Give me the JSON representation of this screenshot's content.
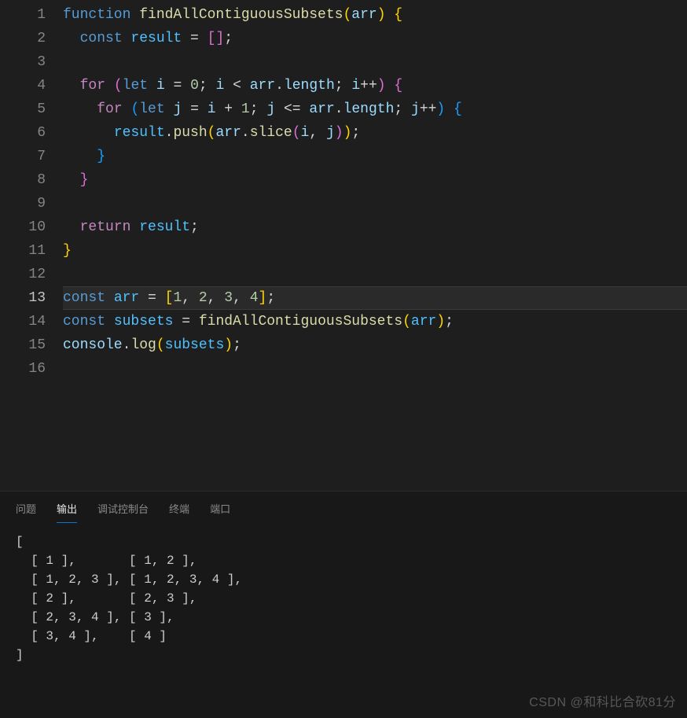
{
  "editor": {
    "highlighted_line_index": 12,
    "line_numbers": [
      "1",
      "2",
      "3",
      "4",
      "5",
      "6",
      "7",
      "8",
      "9",
      "10",
      "11",
      "12",
      "13",
      "14",
      "15",
      "16"
    ],
    "code_tokens": [
      [
        [
          "kw",
          "function "
        ],
        [
          "fn",
          "findAllContiguousSubsets"
        ],
        [
          "brR",
          "("
        ],
        [
          "var",
          "arr"
        ],
        [
          "brR",
          ") "
        ],
        [
          "brR",
          "{"
        ]
      ],
      [
        [
          "punc",
          "  "
        ],
        [
          "kw",
          "const "
        ],
        [
          "const",
          "result"
        ],
        [
          "punc",
          " = "
        ],
        [
          "brP",
          "["
        ],
        [
          "brP",
          "]"
        ],
        [
          "punc",
          ";"
        ]
      ],
      [],
      [
        [
          "punc",
          "  "
        ],
        [
          "ctrl",
          "for "
        ],
        [
          "brP",
          "("
        ],
        [
          "kw",
          "let "
        ],
        [
          "var",
          "i"
        ],
        [
          "punc",
          " = "
        ],
        [
          "num",
          "0"
        ],
        [
          "punc",
          "; "
        ],
        [
          "var",
          "i"
        ],
        [
          "punc",
          " < "
        ],
        [
          "var",
          "arr"
        ],
        [
          "punc",
          "."
        ],
        [
          "var",
          "length"
        ],
        [
          "punc",
          "; "
        ],
        [
          "var",
          "i"
        ],
        [
          "punc",
          "++"
        ],
        [
          "brP",
          ") "
        ],
        [
          "brP",
          "{"
        ]
      ],
      [
        [
          "punc",
          "    "
        ],
        [
          "ctrl",
          "for "
        ],
        [
          "brB",
          "("
        ],
        [
          "kw",
          "let "
        ],
        [
          "var",
          "j"
        ],
        [
          "punc",
          " = "
        ],
        [
          "var",
          "i"
        ],
        [
          "punc",
          " + "
        ],
        [
          "num",
          "1"
        ],
        [
          "punc",
          "; "
        ],
        [
          "var",
          "j"
        ],
        [
          "punc",
          " <= "
        ],
        [
          "var",
          "arr"
        ],
        [
          "punc",
          "."
        ],
        [
          "var",
          "length"
        ],
        [
          "punc",
          "; "
        ],
        [
          "var",
          "j"
        ],
        [
          "punc",
          "++"
        ],
        [
          "brB",
          ") "
        ],
        [
          "brB",
          "{"
        ]
      ],
      [
        [
          "punc",
          "      "
        ],
        [
          "const",
          "result"
        ],
        [
          "punc",
          "."
        ],
        [
          "fn",
          "push"
        ],
        [
          "brR",
          "("
        ],
        [
          "var",
          "arr"
        ],
        [
          "punc",
          "."
        ],
        [
          "fn",
          "slice"
        ],
        [
          "brP",
          "("
        ],
        [
          "var",
          "i"
        ],
        [
          "punc",
          ", "
        ],
        [
          "var",
          "j"
        ],
        [
          "brP",
          ")"
        ],
        [
          "brR",
          ")"
        ],
        [
          "punc",
          ";"
        ]
      ],
      [
        [
          "punc",
          "    "
        ],
        [
          "brB",
          "}"
        ]
      ],
      [
        [
          "punc",
          "  "
        ],
        [
          "brP",
          "}"
        ]
      ],
      [],
      [
        [
          "punc",
          "  "
        ],
        [
          "ctrl",
          "return "
        ],
        [
          "const",
          "result"
        ],
        [
          "punc",
          ";"
        ]
      ],
      [
        [
          "brR",
          "}"
        ]
      ],
      [],
      [
        [
          "kw",
          "const "
        ],
        [
          "const",
          "arr"
        ],
        [
          "punc",
          " = "
        ],
        [
          "brR",
          "["
        ],
        [
          "num",
          "1"
        ],
        [
          "punc",
          ", "
        ],
        [
          "num",
          "2"
        ],
        [
          "punc",
          ", "
        ],
        [
          "num",
          "3"
        ],
        [
          "punc",
          ", "
        ],
        [
          "num",
          "4"
        ],
        [
          "brR",
          "]"
        ],
        [
          "punc",
          ";"
        ]
      ],
      [
        [
          "kw",
          "const "
        ],
        [
          "const",
          "subsets"
        ],
        [
          "punc",
          " = "
        ],
        [
          "fn",
          "findAllContiguousSubsets"
        ],
        [
          "brR",
          "("
        ],
        [
          "const",
          "arr"
        ],
        [
          "brR",
          ")"
        ],
        [
          "punc",
          ";"
        ]
      ],
      [
        [
          "var",
          "console"
        ],
        [
          "punc",
          "."
        ],
        [
          "fn",
          "log"
        ],
        [
          "brR",
          "("
        ],
        [
          "const",
          "subsets"
        ],
        [
          "brR",
          ")"
        ],
        [
          "punc",
          ";"
        ]
      ],
      []
    ]
  },
  "panel": {
    "tabs": [
      {
        "id": "problems",
        "label": "问题",
        "active": false
      },
      {
        "id": "output",
        "label": "输出",
        "active": true
      },
      {
        "id": "debug",
        "label": "调试控制台",
        "active": false
      },
      {
        "id": "terminal",
        "label": "终端",
        "active": false
      },
      {
        "id": "ports",
        "label": "端口",
        "active": false
      }
    ],
    "output_text": "[\n  [ 1 ],       [ 1, 2 ],\n  [ 1, 2, 3 ], [ 1, 2, 3, 4 ],\n  [ 2 ],       [ 2, 3 ],\n  [ 2, 3, 4 ], [ 3 ],\n  [ 3, 4 ],    [ 4 ]\n]"
  },
  "watermark": "CSDN @和科比合砍81分"
}
